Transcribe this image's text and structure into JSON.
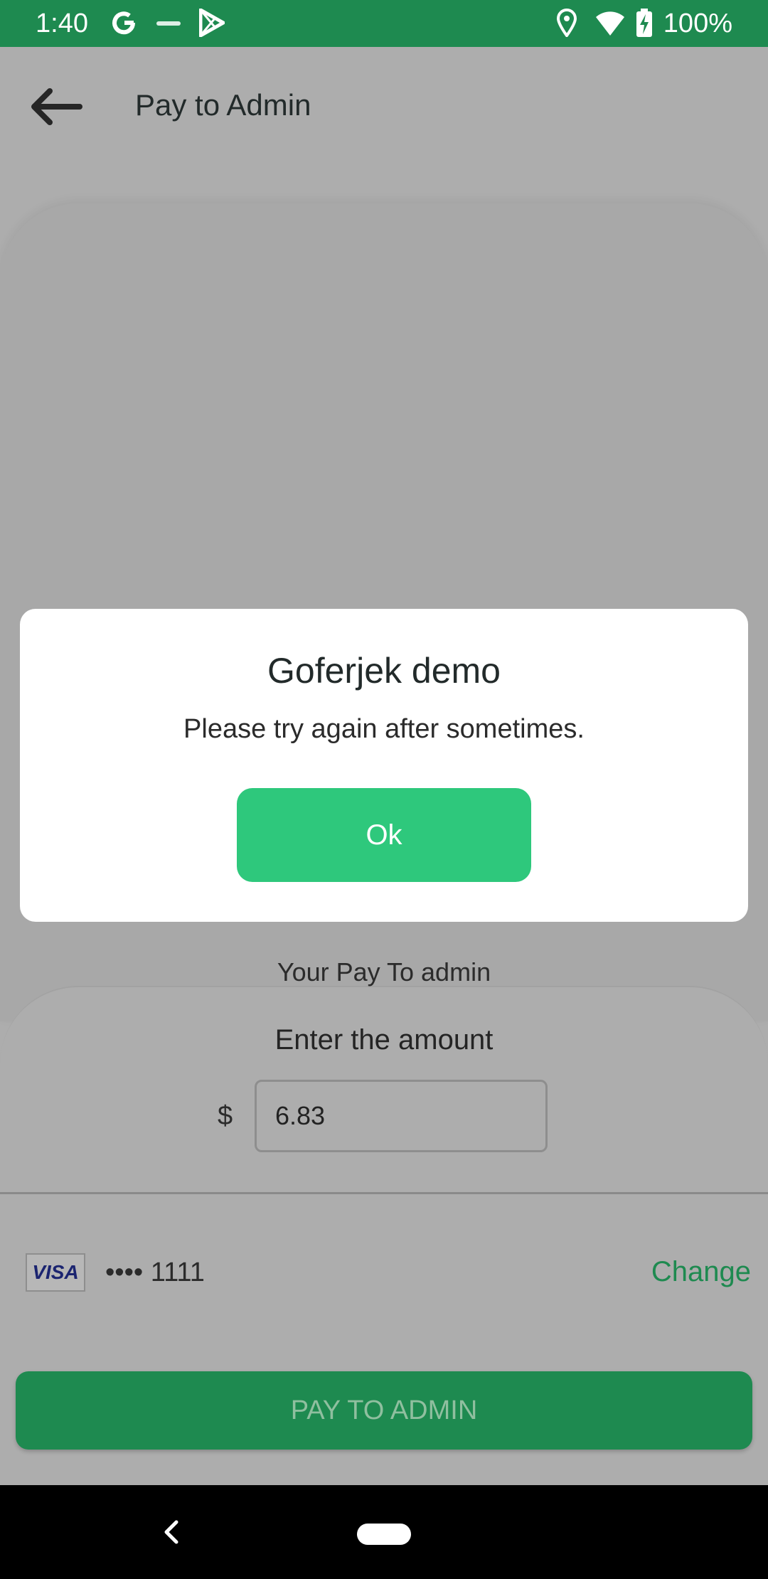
{
  "status_bar": {
    "time": "1:40",
    "battery": "100%",
    "icons": [
      "google-g-icon",
      "app-notification-icon",
      "play-store-icon",
      "location-icon",
      "wifi-icon",
      "battery-charging-icon"
    ]
  },
  "toolbar": {
    "back_icon": "back-arrow-icon",
    "title": "Pay to Admin"
  },
  "payment": {
    "pay_label": "Your Pay To admin",
    "amount_title": "Enter the amount",
    "currency": "$",
    "amount_value": "6.83"
  },
  "card": {
    "brand": "VISA",
    "number": "•••• 1111",
    "change_label": "Change"
  },
  "pay_button_label": "PAY TO ADMIN",
  "dialog": {
    "title": "Goferjek demo",
    "message": "Please try again after sometimes.",
    "ok_label": "Ok"
  },
  "colors": {
    "status_bar": "#1e8a50",
    "primary_green": "#1e8a50",
    "ok_button": "#2ec87c",
    "scrim_background": "#adadad"
  }
}
